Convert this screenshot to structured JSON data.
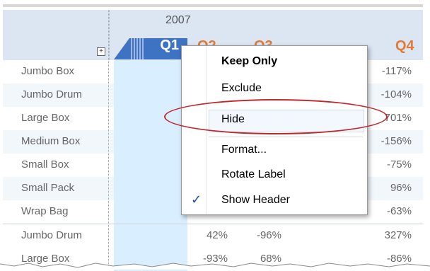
{
  "header": {
    "year": "2007",
    "quarters": [
      "Q1",
      "Q2",
      "Q3",
      "Q4"
    ],
    "expand_symbol": "+"
  },
  "rows": [
    {
      "label": "Jumbo Box",
      "q4": "-117%"
    },
    {
      "label": "Jumbo Drum",
      "q4": "-104%"
    },
    {
      "label": "Large Box",
      "q4": "701%"
    },
    {
      "label": "Medium Box",
      "q4": "-156%"
    },
    {
      "label": "Small Box",
      "q4": "-75%"
    },
    {
      "label": "Small Pack",
      "q4": "96%"
    },
    {
      "label": "Wrap Bag",
      "q4": "-63%"
    },
    {
      "label": "Jumbo Drum",
      "q2": "42%",
      "q3": "-96%",
      "q4": "327%"
    },
    {
      "label": "Large Box",
      "q2": "-93%",
      "q3": "68%",
      "q4": "-86%"
    }
  ],
  "context_menu": {
    "items": [
      "Keep Only",
      "Exclude",
      "Hide",
      "Format...",
      "Rotate Label",
      "Show Header"
    ],
    "checked_item": "Show Header",
    "check_glyph": "✓"
  },
  "colors": {
    "header_bg": "#dce6f2",
    "selected_tab": "#3e73c4",
    "quarter_label": "#e07b39",
    "selected_column": "#d9efff",
    "annotation_ellipse": "#c0282e"
  }
}
